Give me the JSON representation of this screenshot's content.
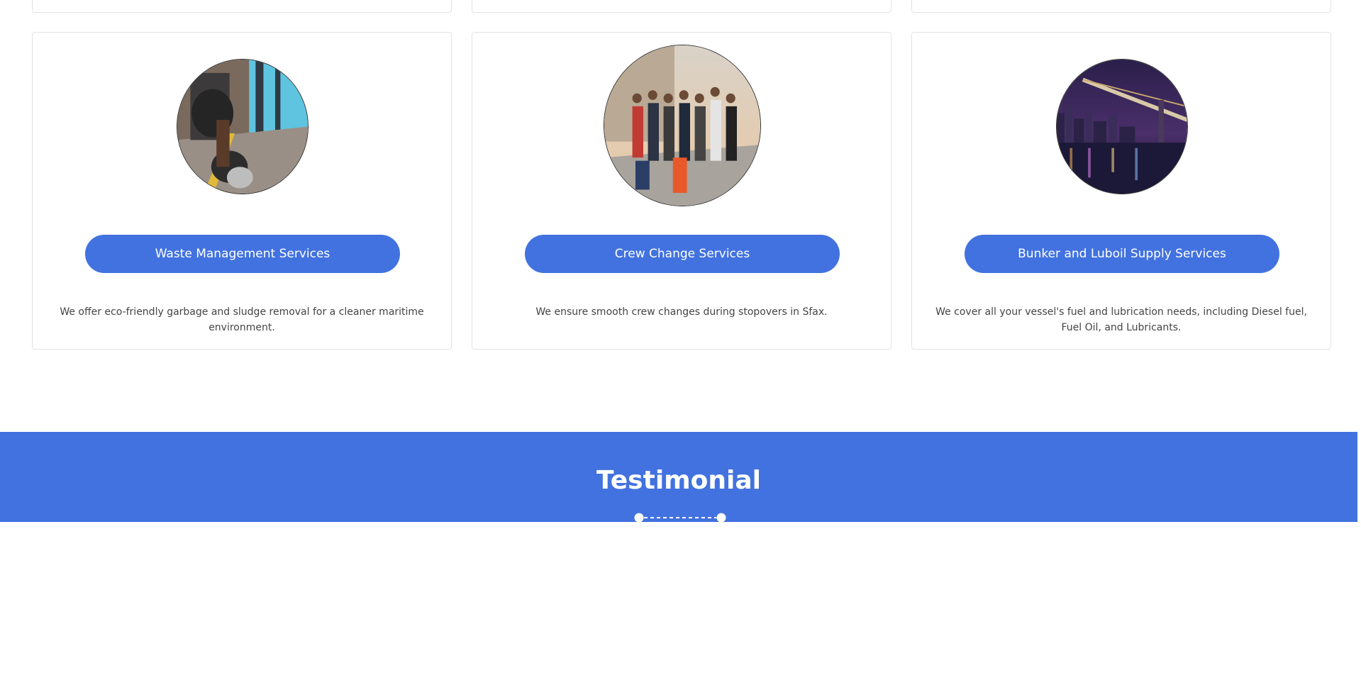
{
  "services": [
    {
      "button_label": "Waste Management Services",
      "description": "We offer eco-friendly garbage and sludge removal for a cleaner maritime environment.",
      "image_icon": "waste-management-photo"
    },
    {
      "button_label": "Crew Change Services",
      "description": "We ensure smooth crew changes during stopovers in Sfax.",
      "image_icon": "crew-change-photo"
    },
    {
      "button_label": "Bunker and Luboil Supply Services",
      "description": "We cover all your vessel's fuel and lubrication needs, including Diesel fuel, Fuel Oil, and Lubricants.",
      "image_icon": "city-bridge-photo"
    }
  ],
  "testimonial": {
    "title": "Testimonial"
  },
  "colors": {
    "accent": "#4272df",
    "card_border": "#e3e3e3",
    "text": "#444444"
  }
}
